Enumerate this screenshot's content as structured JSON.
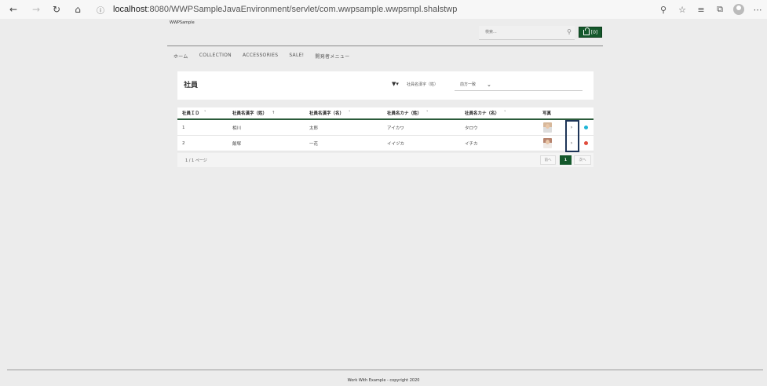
{
  "browser": {
    "url_host": "localhost",
    "url_rest": ":8080/WWPSampleJavaEnvironment/servlet/com.wwpsample.wwpsmpl.shalstwp"
  },
  "header": {
    "brand": "WWPSample",
    "search_placeholder": "検索...",
    "cart_count": "[0]"
  },
  "menu": [
    "ホーム",
    "COLLECTION",
    "ACCESSORIES",
    "SALE!",
    "開発者メニュー"
  ],
  "panel": {
    "title": "社員",
    "filter_label": "社員名漢字（姓）",
    "filter_value": "前方一致"
  },
  "grid": {
    "columns": [
      {
        "label": "社員ＩＤ",
        "sort": "˅"
      },
      {
        "label": "社員名漢字（姓）",
        "sort": "↑"
      },
      {
        "label": "社員名漢字（名）",
        "sort": "˅"
      },
      {
        "label": "社員名カナ（姓）",
        "sort": "˅"
      },
      {
        "label": "社員名カナ（名）",
        "sort": "˅"
      },
      {
        "label": "写真",
        "sort": ""
      }
    ],
    "rows": [
      {
        "id": "1",
        "last": "相川",
        "first": "太郎",
        "last_kana": "アイカワ",
        "first_kana": "タロウ",
        "photo": "male",
        "status_color": "#1fb5d6"
      },
      {
        "id": "2",
        "last": "飯塚",
        "first": "一花",
        "last_kana": "イイヅカ",
        "first_kana": "イチカ",
        "photo": "female",
        "status_color": "#e04c3c"
      }
    ],
    "row_action": "›"
  },
  "pager": {
    "pages_text": "1 / 1 ページ",
    "prev": "前へ",
    "current": "1",
    "next": "次へ"
  },
  "footer": "Work With Example - copyright 2020",
  "colors": {
    "accent": "#14582b",
    "selection": "#1e3558"
  }
}
